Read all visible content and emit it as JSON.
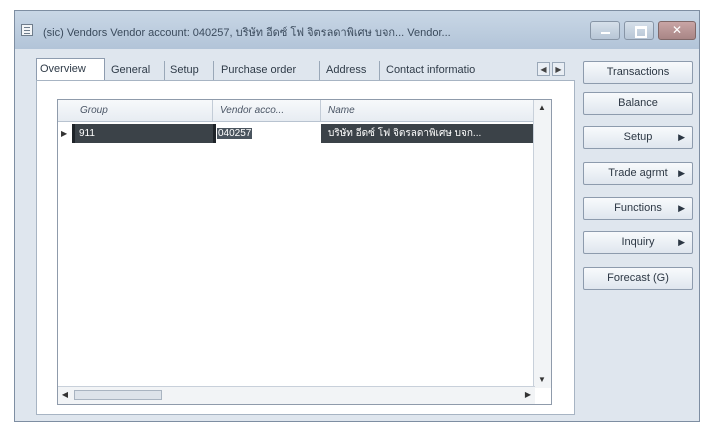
{
  "window": {
    "title": "(sic) Vendors  Vendor account: 040257, บริษัท อีดซ์ โฟ จิตรลดาพิเศษ บจก... Vendor..."
  },
  "tabs": [
    {
      "label": "Overview",
      "active": true
    },
    {
      "label": "General"
    },
    {
      "label": "Setup"
    },
    {
      "label": "Purchase order"
    },
    {
      "label": "Address"
    },
    {
      "label": "Contact informatio"
    }
  ],
  "grid": {
    "columns": [
      "Group",
      "Vendor acco...",
      "Name"
    ],
    "rows": [
      {
        "group": "911",
        "vendor_account": "040257",
        "name": "บริษัท อีดซ์ โฟ จิตรลดาพิเศษ บจก..."
      }
    ]
  },
  "side_buttons": [
    {
      "label": "Transactions",
      "has_menu": false
    },
    {
      "label": "Balance",
      "has_menu": false
    },
    {
      "label": "Setup",
      "has_menu": true
    },
    {
      "label": "Trade agrmt",
      "has_menu": true
    },
    {
      "label": "Functions",
      "has_menu": true
    },
    {
      "label": "Inquiry",
      "has_menu": true
    },
    {
      "label": "Forecast (G)",
      "has_menu": false
    }
  ],
  "colors": {
    "selected_row": "#3b4248",
    "window_bg": "#dfe6ee",
    "titlebar": "#b8c8da"
  }
}
